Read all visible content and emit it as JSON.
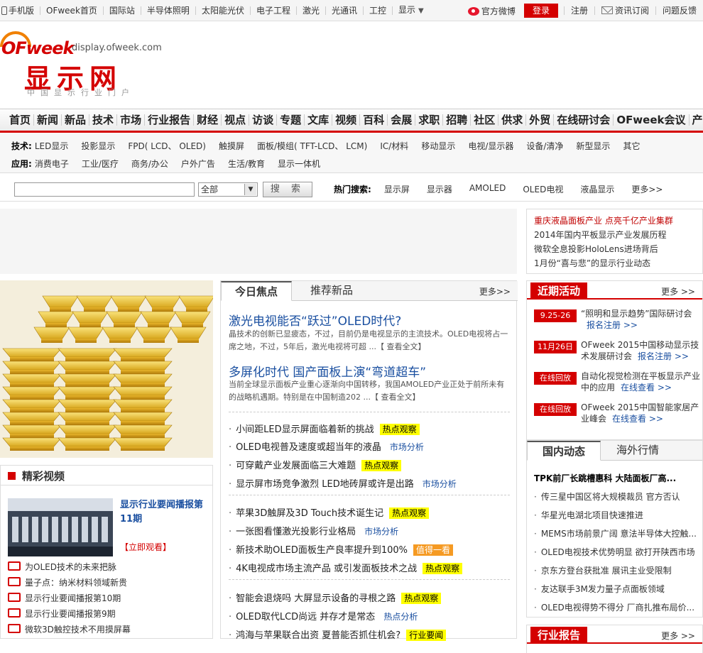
{
  "topbar": {
    "left": [
      "手机版",
      "OFweek首页",
      "国际站",
      "半导体照明",
      "太阳能光伏",
      "电子工程",
      "激光",
      "光通讯",
      "工控",
      "显示"
    ],
    "weibo": "官方微博",
    "login": "登录",
    "register": "注册",
    "subscribe": "资讯订阅",
    "feedback": "问题反馈"
  },
  "logo": {
    "brand": "OFweek",
    "domain": "display.ofweek.com",
    "name": "显示网",
    "tagline": "中国显示行业门户"
  },
  "mainnav": [
    "首页",
    "新闻",
    "新品",
    "技术",
    "市场",
    "行业报告",
    "财经",
    "视点",
    "访谈",
    "专题",
    "文库",
    "视频",
    "百科",
    "会展",
    "求职",
    "招聘",
    "社区",
    "供求",
    "外贸",
    "在线研讨会",
    "OFweek会议",
    "产品试用"
  ],
  "subnav": {
    "tech_label": "技术:",
    "tech": [
      "LED显示",
      "投影显示",
      "FPD( LCD、 OLED)",
      "触摸屏",
      "面板/模组( TFT-LCD、 LCM)",
      "IC/材料",
      "移动显示",
      "电视/显示器",
      "设备/清净",
      "新型显示",
      "其它"
    ],
    "app_label": "应用:",
    "app": [
      "消费电子",
      "工业/医疗",
      "商务/办公",
      "户外广告",
      "生活/教育",
      "显示一体机"
    ]
  },
  "search": {
    "select": "全部",
    "button": "搜 索",
    "hot_label": "热门搜索:",
    "hot": [
      "显示屏",
      "显示器",
      "AMOLED",
      "OLED电视",
      "液晶显示"
    ],
    "more": "更多>>"
  },
  "rtlinks": [
    {
      "text": "重庆液晶面板产业 点亮千亿产业集群",
      "color": "#c00000"
    },
    {
      "text": "2014年国内平板显示产业发展历程",
      "color": "#333"
    },
    {
      "text": "微软全息投影HoloLens进场背后",
      "color": "#333"
    },
    {
      "text": "1月份“喜与悲”的显示行业动态",
      "color": "#333"
    }
  ],
  "focus": {
    "tab1": "今日焦点",
    "tab2": "推荐新品",
    "more": "更多>>",
    "h1": "激光电视能否“跃过”OLED时代?",
    "s1": "晶技术的创新已显疲态，不过，目前仍是电视显示的主流技术。OLED电视将占一席之地，不过，5年后，激光电视将可超 ...【 查看全文】",
    "h2": "多屏化时代 国产面板上演“弯道超车”",
    "s2": "当前全球显示面板产业重心逐渐向中国转移，我国AMOLED产业正处于前所未有的战略机遇期。特别是在中国制造202 ...【 查看全文】",
    "list": [
      {
        "t": "小间距LED显示屏面临着新的挑战",
        "tag": "热点观察",
        "k": "y"
      },
      {
        "t": "OLED电视普及速度或超当年的液晶",
        "tag": "市场分析",
        "k": "b"
      },
      {
        "t": "可穿戴产业发展面临三大难题",
        "tag": "热点观察",
        "k": "y"
      },
      {
        "t": "显示屏市场竞争激烈 LED地砖屏或许是出路",
        "tag": "市场分析",
        "k": "b"
      },
      {
        "t": "苹果3D触屏及3D Touch技术诞生记",
        "tag": "热点观察",
        "k": "y"
      },
      {
        "t": "一张图看懂激光投影行业格局",
        "tag": "市场分析",
        "k": "b"
      },
      {
        "t": "新技术助OLED面板生产良率提升到100%",
        "tag": "值得一看",
        "k": "o"
      },
      {
        "t": "4K电视成市场主流产品 或引发面板技术之战",
        "tag": "热点观察",
        "k": "y"
      },
      {
        "t": "智能会退烧吗 大屏显示设备的寻根之路",
        "tag": "热点观察",
        "k": "y"
      },
      {
        "t": "OLED取代LCD尚远 并存才是常态",
        "tag": "热点分析",
        "k": "b"
      },
      {
        "t": "鸿海与苹果联合出资 夏普能否抓住机会?",
        "tag": "行业要闻",
        "k": "y"
      }
    ]
  },
  "video": {
    "title": "精彩视频",
    "feature_title": "显示行业要闻播报第11期",
    "watch": "【立即观看】",
    "list": [
      "为OLED技术的未来把脉",
      "量子点：纳米材料领域新贵",
      "显示行业要闻播报第10期",
      "显示行业要闻播报第9期",
      "微软3D触控技术不用摸屏幕"
    ]
  },
  "events": {
    "title": "近期活动",
    "more": "更多 >>",
    "items": [
      {
        "d": "9.25-26",
        "t": "“照明和显示趋势”国际研讨会",
        "l": "报名注册 >>"
      },
      {
        "d": "11月26日",
        "t": "OFweek 2015中国移动显示技术发展研讨会",
        "l": "报名注册 >>"
      },
      {
        "d": "在线回放",
        "t": "自动化视觉检测在平板显示产业中的应用",
        "l": "在线查看 >>"
      },
      {
        "d": "在线回放",
        "t": "OFweek 2015中国智能家居产业峰会",
        "l": "在线查看 >>"
      }
    ]
  },
  "news": {
    "tab1": "国内动态",
    "tab2": "海外行情",
    "headline": "TPK前厂长跳槽惠科 大陆面板厂高...",
    "list": [
      "传三星中国区将大规模裁员 官方否认",
      "华星光电湖北项目快速推进",
      "MEMS市场前景广阔 意法半导体大控触...",
      "OLED电视技术优势明显 欲打开陕西市场",
      "京东方登台获批准 展讯主业受限制",
      "友达联手3M发力量子点面板领域",
      "OLED电视得势不得分 厂商扎推布局价..."
    ]
  },
  "report": {
    "title": "行业报告",
    "more": "更多 >>"
  }
}
